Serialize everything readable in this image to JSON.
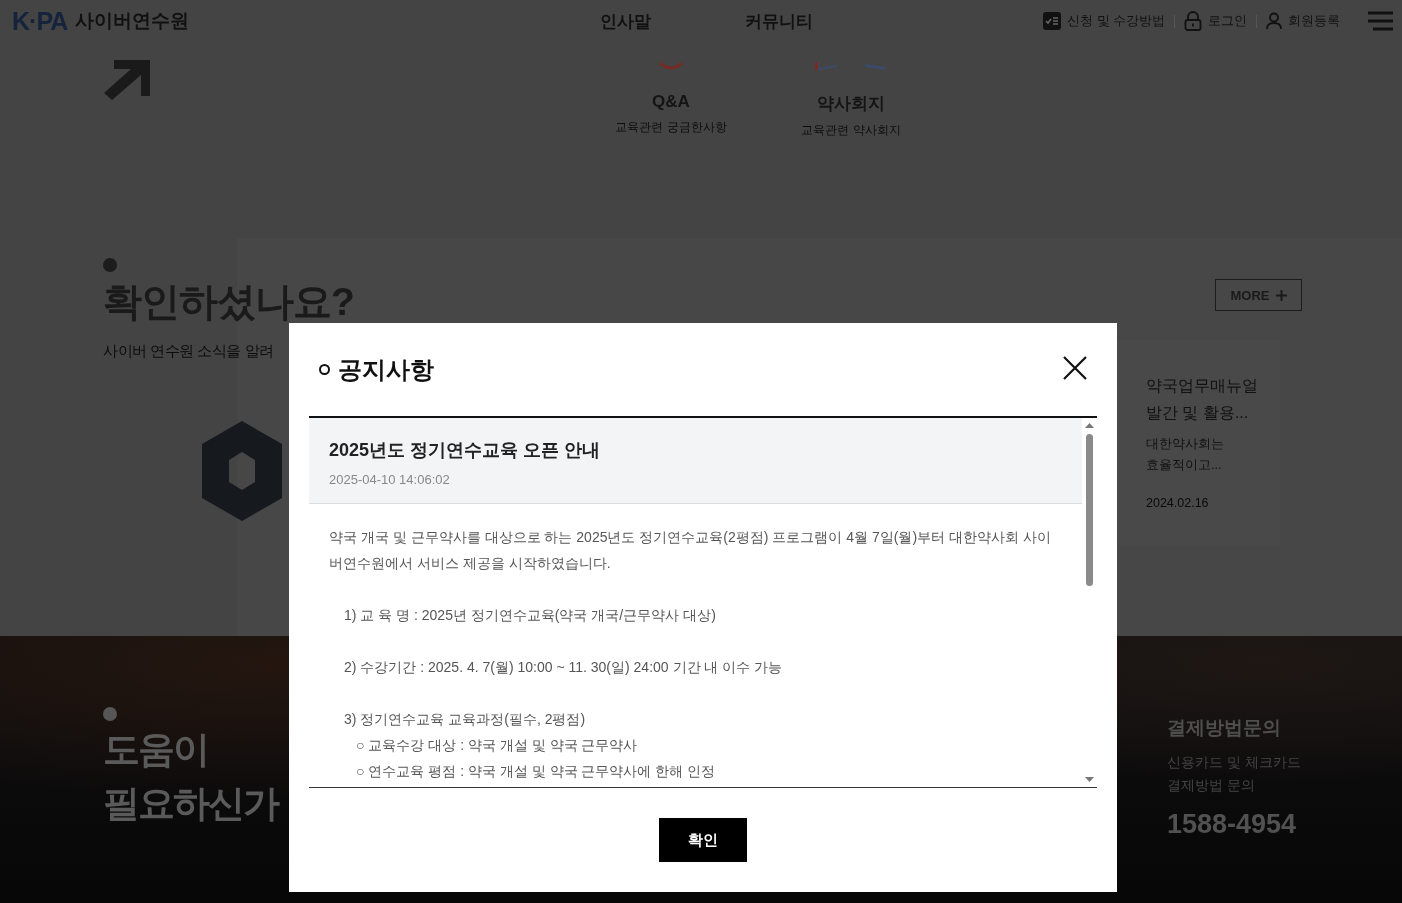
{
  "header": {
    "logo": "K·PA",
    "site_name": "사이버연수원",
    "nav": [
      "인사말",
      "커뮤니티"
    ],
    "utility_links": [
      {
        "label": "신청 및 수강방법",
        "kind": "guide"
      },
      {
        "label": "로그인",
        "kind": "login"
      },
      {
        "label": "회원등록",
        "kind": "register"
      }
    ]
  },
  "quick_menu": [
    {
      "title": "Q&A",
      "description": "교육관련 궁금한사항",
      "kind": "qa"
    },
    {
      "title": "약사회지",
      "description": "교육관련 약사회지",
      "kind": "journal"
    }
  ],
  "notice_section": {
    "heading": "확인하셨나요?",
    "subtitle": "사이버 연수원 소식을 알려",
    "more_button": "MORE",
    "card": {
      "title": "약국업무매뉴얼 발간 및 활용...",
      "description": "대한약사회는 효율적이고...",
      "date": "2024.02.16"
    }
  },
  "help_section": {
    "heading": [
      "도움이",
      "필요하신가"
    ],
    "contact": {
      "title": "결제방법문의",
      "description": "신용카드 및 체크카드 결제방법 문의",
      "phone": "1588-4954"
    }
  },
  "modal": {
    "title": "공지사항",
    "notice": {
      "title": "2025년도 정기연수교육 오픈 안내",
      "date": "2025-04-10 14:06:02",
      "paragraph": "약국 개국 및 근무약사를 대상으로 하는 2025년도 정기연수교육(2평점) 프로그램이 4월 7일(월)부터 대한약사회 사이버연수원에서 서비스 제공을 시작하였습니다.",
      "items": [
        {
          "text": "1) 교 육 명 : 2025년 정기연수교육(약국 개국/근무약사 대상)",
          "kind": "numbered"
        },
        {
          "text": "2) 수강기간 : 2025. 4. 7(월) 10:00 ~ 11. 30(일) 24:00 기간 내 이수 가능",
          "kind": "numbered"
        },
        {
          "text": "3) 정기연수교육 교육과정(필수, 2평점)",
          "kind": "numbered"
        },
        {
          "text": "○ 교육수강 대상 : 약국 개설 및 약국 근무약사",
          "kind": "sub"
        },
        {
          "text": "○ 연수교육 평점 : 약국 개설 및 약국 근무약사에 한해 인정",
          "kind": "sub"
        }
      ]
    },
    "confirm_button": "확인"
  }
}
